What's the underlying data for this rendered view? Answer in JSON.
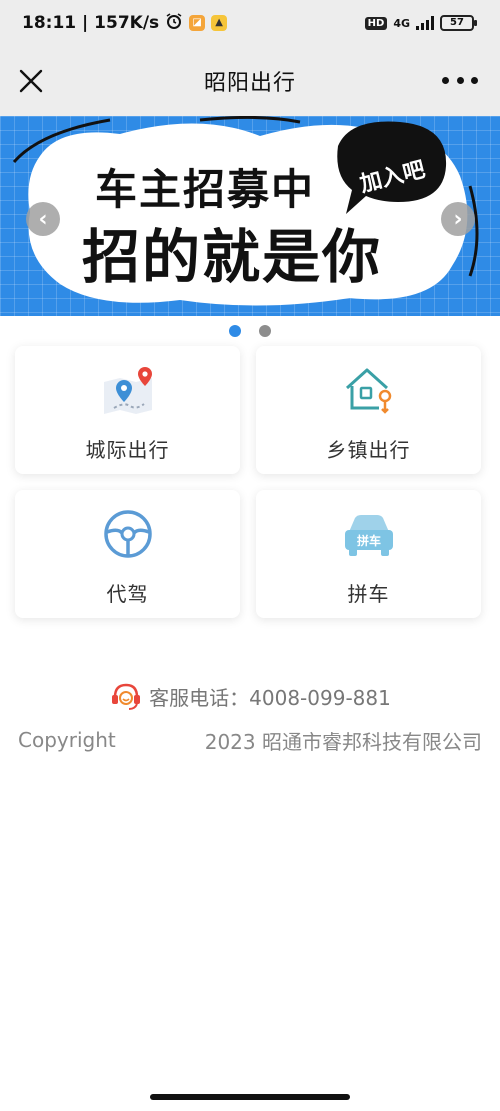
{
  "status_bar": {
    "time_speed": "18:11 | 157K/s",
    "network": "4G",
    "hd": "HD",
    "battery": "57"
  },
  "nav": {
    "title": "昭阳出行"
  },
  "banner": {
    "line1": "车主招募中",
    "line2": "招的就是你",
    "badge": "加入吧",
    "prev_arrow": "‹",
    "next_arrow": "›",
    "page_count": 2,
    "active_page": 1
  },
  "services": [
    {
      "label": "城际出行",
      "icon": "map-pin-icon"
    },
    {
      "label": "乡镇出行",
      "icon": "house-pin-icon"
    },
    {
      "label": "代驾",
      "icon": "steering-wheel-icon"
    },
    {
      "label": "拼车",
      "icon": "carpool-icon"
    }
  ],
  "carpool_icon_text": "拼车",
  "footer": {
    "hotline": "客服电话：4008-099-881",
    "copyright_left": "Copyright",
    "copyright_right": "2023 昭通市睿邦科技有限公司"
  },
  "colors": {
    "accent": "#2f8be6",
    "banner_bg": "#2f8be6",
    "icon_blue": "#5b9bd5",
    "icon_orange": "#f08a2e",
    "icon_red": "#e8463b"
  }
}
